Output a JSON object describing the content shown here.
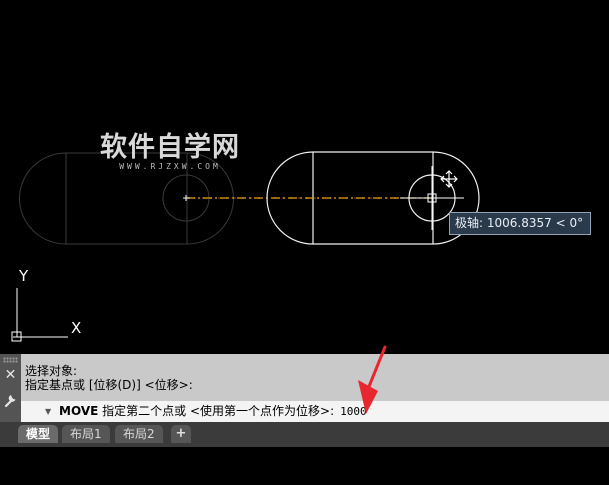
{
  "canvas": {
    "watermark": {
      "title": "软件自学网",
      "subtitle": "WWW.RJZXW.COM"
    },
    "tooltip": {
      "label": "极轴:",
      "value": "1006.8357 < 0°"
    },
    "ucs": {
      "x_label": "X",
      "y_label": "Y"
    }
  },
  "command": {
    "history": [
      "选择对象:",
      "指定基点或 [位移(D)] <位移>:"
    ],
    "command_name": "MOVE",
    "prompt": "指定第二个点或 <使用第一个点作为位移>:",
    "input_value": "1000"
  },
  "tabs": [
    {
      "label": "模型",
      "active": true
    },
    {
      "label": "布局1",
      "active": false
    },
    {
      "label": "布局2",
      "active": false
    }
  ],
  "add_tab_label": "+",
  "icons": {
    "close": "close-icon",
    "wrench": "wrench-icon",
    "chevron": "chevron-down-icon",
    "move_grip": "move-grip-icon"
  },
  "colors": {
    "background": "#000000",
    "ghost_geometry": "#3a3a3a",
    "geometry": "#f0f0f0",
    "rubber_band": "#f2a000",
    "annotation_arrow": "#e8262f",
    "command_bg": "#c9c9c9"
  }
}
